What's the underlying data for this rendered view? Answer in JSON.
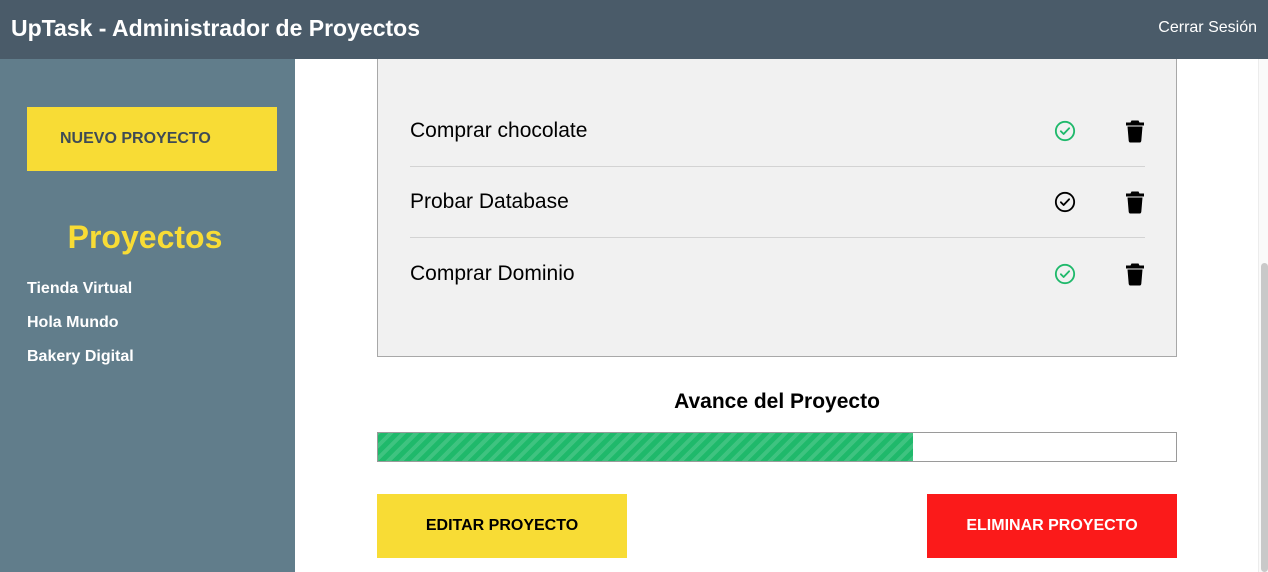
{
  "header": {
    "title": "UpTask - Administrador de Proyectos",
    "logout_label": "Cerrar Sesión"
  },
  "sidebar": {
    "new_project_label": "NUEVO PROYECTO",
    "projects_title": "Proyectos",
    "projects": [
      "Tienda Virtual",
      "Hola Mundo",
      "Bakery Digital"
    ]
  },
  "tasks": [
    {
      "name": "Comprar chocolate",
      "completed": true,
      "check_icon": "check-circle-icon",
      "delete_icon": "trash-icon"
    },
    {
      "name": "Probar Database",
      "completed": false,
      "check_icon": "check-circle-icon",
      "delete_icon": "trash-icon"
    },
    {
      "name": "Comprar Dominio",
      "completed": true,
      "check_icon": "check-circle-icon",
      "delete_icon": "trash-icon"
    }
  ],
  "progress": {
    "title": "Avance del Proyecto",
    "fraction": 0.67
  },
  "actions": {
    "edit_label": "EDITAR PROYECTO",
    "delete_label": "ELIMINAR PROYECTO"
  },
  "colors": {
    "header_bg": "#4a5b69",
    "sidebar_bg": "#617d8b",
    "accent_yellow": "#f8dc35",
    "danger_red": "#fb1a1a",
    "success_green": "#1fb96b",
    "check_pending": "#000000"
  }
}
